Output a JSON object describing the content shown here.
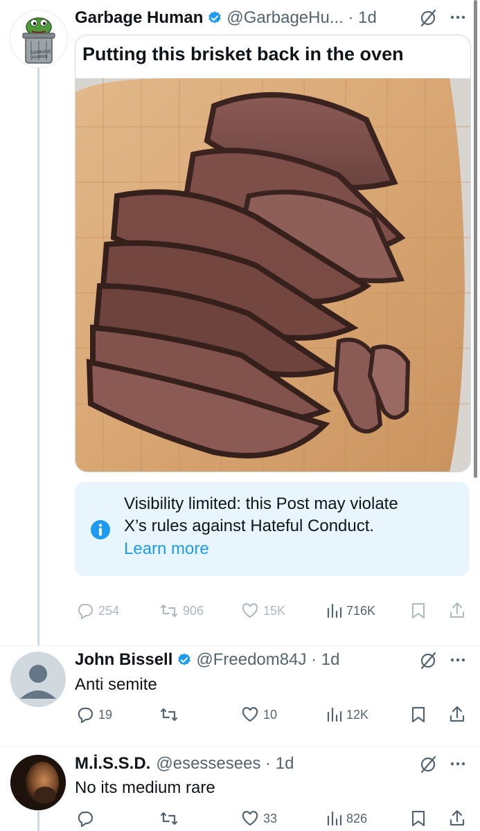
{
  "post": {
    "author_name": "Garbage Human",
    "handle_time": "@GarbageHu... · 1d",
    "avatar_text_top": "GARBAGE",
    "avatar_text_bottom": "HUMAN",
    "image_caption": "Putting this brisket back in the oven",
    "notice_text_line1": "Visibility limited: this Post may violate",
    "notice_text_line2": "X’s rules against Hateful Conduct.",
    "notice_link": "Learn more",
    "stats": {
      "replies": "254",
      "reposts": "906",
      "likes": "15K",
      "views": "716K"
    }
  },
  "replies": [
    {
      "author_name": "John Bissell",
      "handle_time": "@Freedom84J · 1d",
      "text": "Anti semite",
      "stats": {
        "replies": "19",
        "reposts": "",
        "likes": "10",
        "views": "12K"
      }
    },
    {
      "author_name": "M.İ.S.S.D.",
      "handle_time": "@esessesees · 1d",
      "text": "No its medium rare",
      "stats": {
        "replies": "",
        "reposts": "",
        "likes": "33",
        "views": "826"
      }
    }
  ],
  "colors": {
    "accent": "#1d9bf0",
    "muted": "#536471",
    "muted_light": "#aab8c2",
    "notice_bg": "#e8f5fd",
    "divider": "#eff3f4"
  }
}
